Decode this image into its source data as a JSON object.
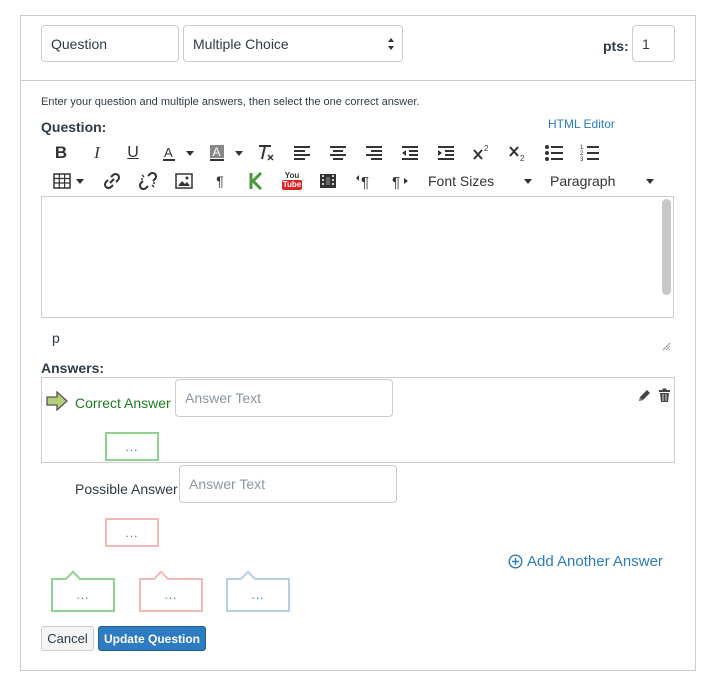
{
  "header": {
    "title_value": "Question",
    "type_select": "Multiple Choice",
    "pts_label": "pts:",
    "pts_value": "1"
  },
  "instructions": "Enter your question and multiple answers, then select the one correct answer.",
  "question_label": "Question:",
  "html_editor_link": "HTML Editor",
  "toolbar": {
    "font_sizes": "Font Sizes",
    "paragraph": "Paragraph",
    "youtube_top": "You",
    "youtube_bottom": "Tube"
  },
  "path_indicator": "p",
  "answers_label": "Answers:",
  "answers": [
    {
      "label": "Correct Answer",
      "placeholder": "Answer Text",
      "comment": "...",
      "color": "#1f7a1f"
    },
    {
      "label": "Possible Answer",
      "placeholder": "Answer Text",
      "comment": "...",
      "color": "#2d3b45"
    }
  ],
  "add_answer": "Add Another Answer",
  "general_comments": [
    "...",
    "...",
    "..."
  ],
  "buttons": {
    "cancel": "Cancel",
    "update": "Update Question"
  },
  "colors": {
    "accent": "#2d7bc0",
    "primary_button": "#2d7bc0",
    "correct": "#1f7a1f",
    "correct_border": "#8fd18f",
    "wrong_border": "#f1b8b8",
    "neutral_border": "#b8cde8"
  }
}
